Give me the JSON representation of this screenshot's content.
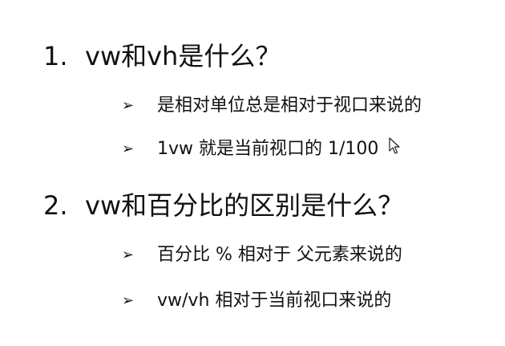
{
  "sections": [
    {
      "number": "1.",
      "title": "vw和vh是什么？",
      "bullets": [
        "是相对单位总是相对于视口来说的",
        "1vw 就是当前视口的 1/100"
      ]
    },
    {
      "number": "2.",
      "title": "vw和百分比的区别是什么？",
      "bullets": [
        "百分比 % 相对于 父元素来说的",
        "vw/vh 相对于当前视口来说的"
      ]
    }
  ],
  "bullet_glyph": "➢",
  "cursor_icon": "mouse-pointer-icon"
}
